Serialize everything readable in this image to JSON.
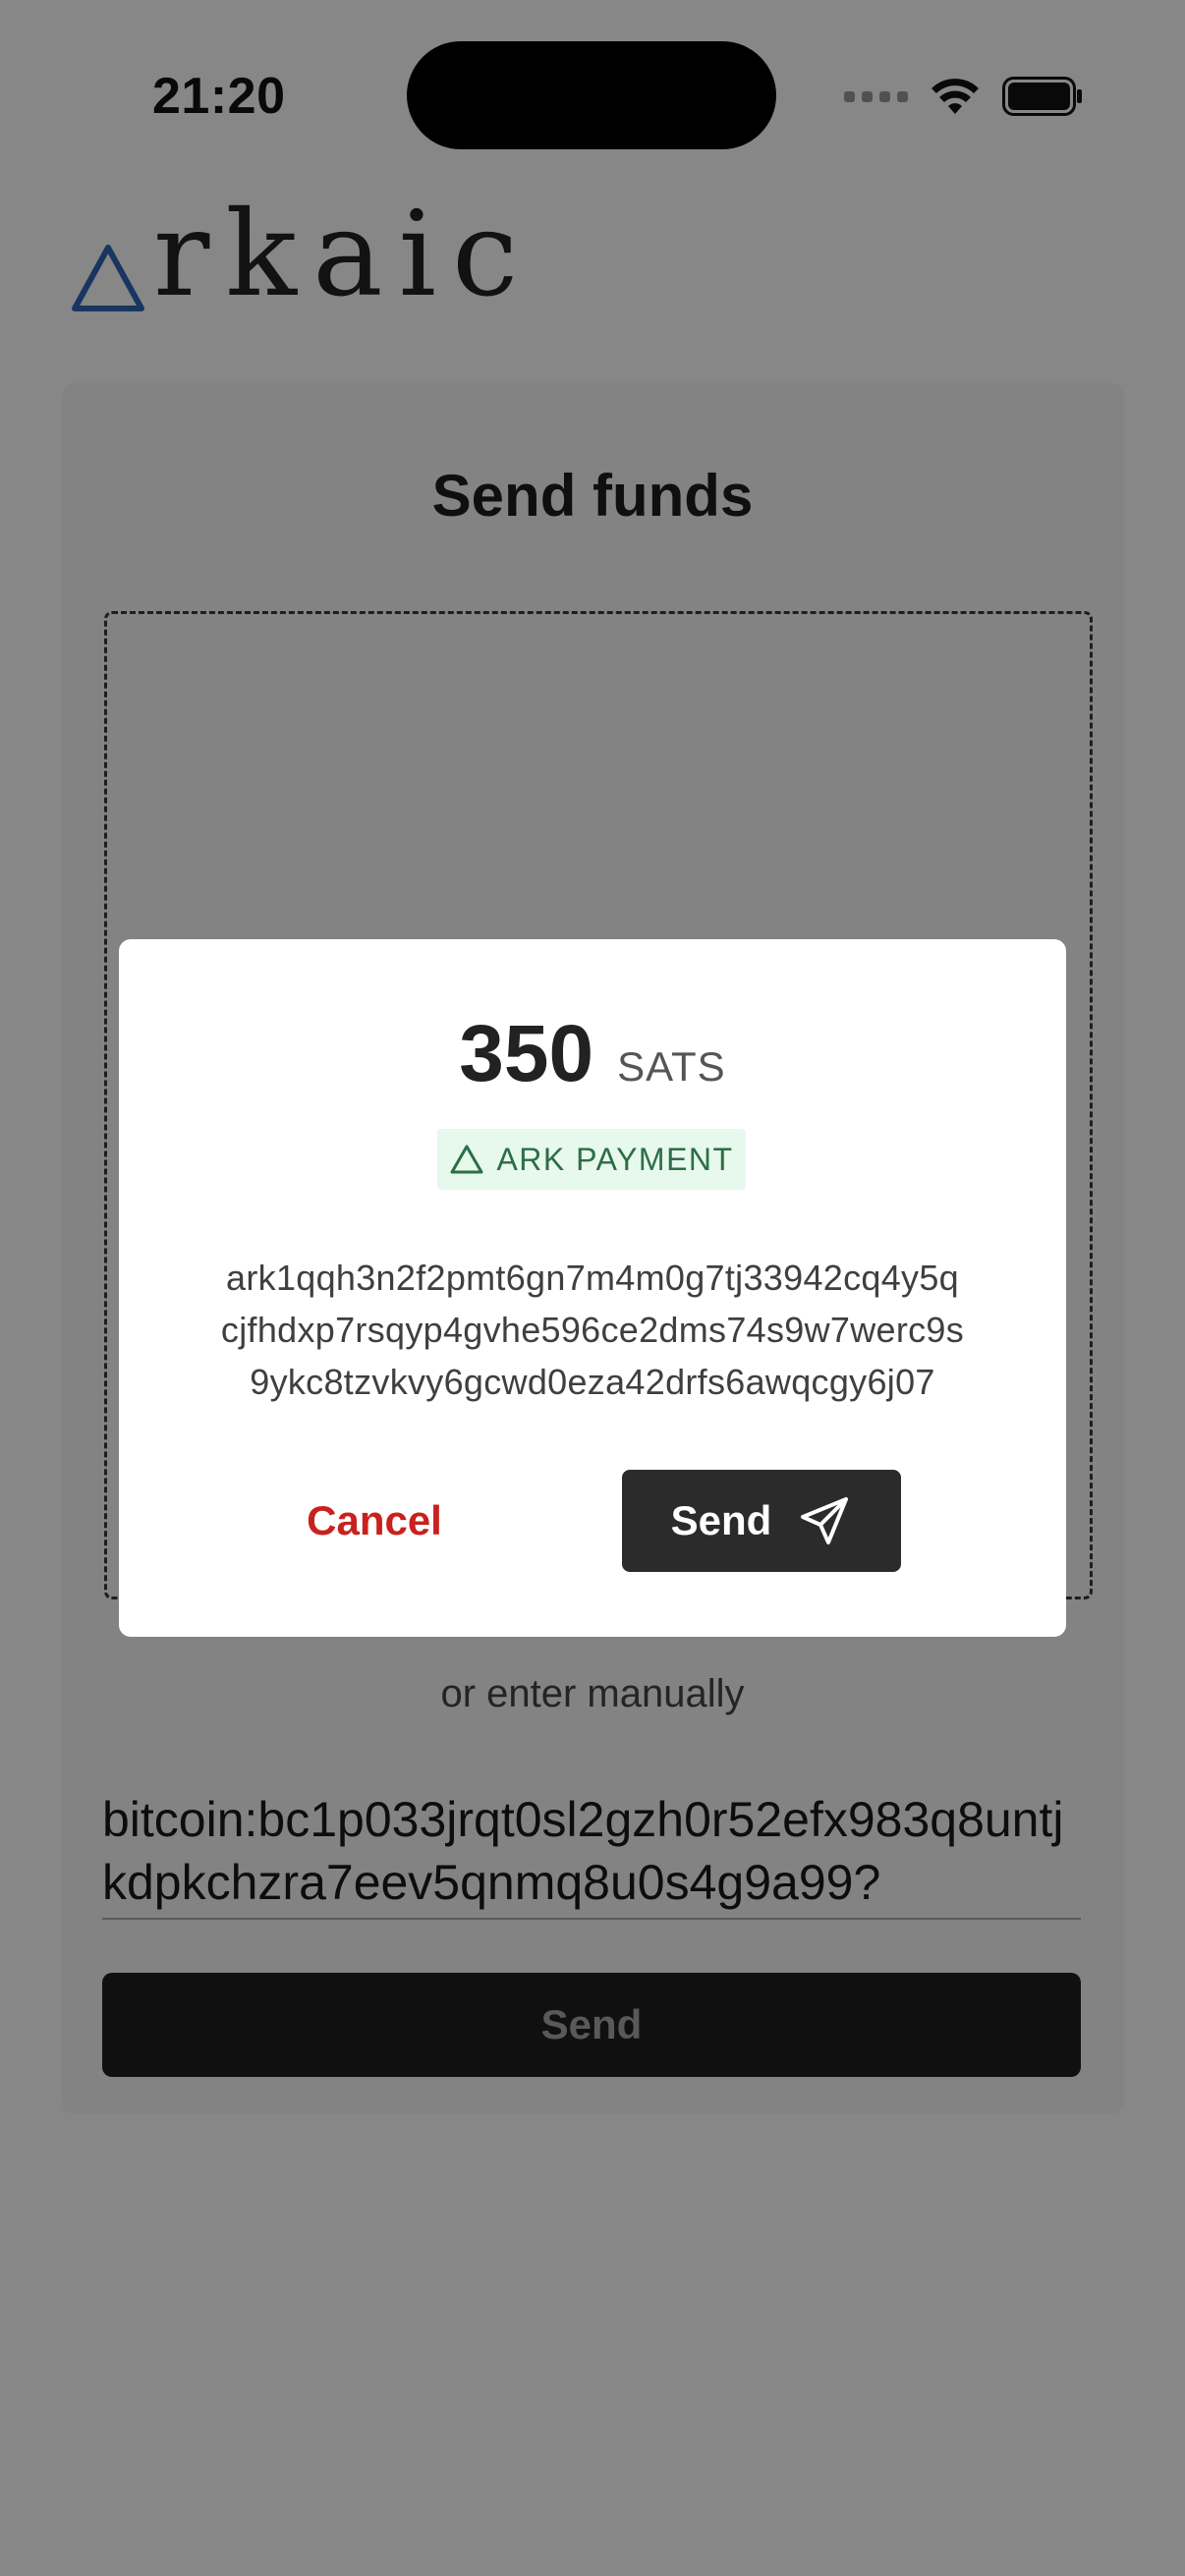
{
  "status_bar": {
    "time": "21:20"
  },
  "logo": {
    "text": "rkaic"
  },
  "page": {
    "title": "Send funds",
    "manual_label": "or enter manually",
    "address_value": "bitcoin:bc1p033jrqt0sl2gzh0r52efx983q8untjkdpkchzra7eev5qnmq8u0s4g9a99?",
    "send_label": "Send"
  },
  "modal": {
    "amount": "350",
    "unit": "SATS",
    "badge": "ARK PAYMENT",
    "address_lines": [
      "ark1qqh3n2f2pmt6gn7m4m0g7tj33942cq4y5q",
      "cjfhdxp7rsqyp4gvhe596ce2dms74s9w7werc9s",
      "9ykc8tzvkvy6gcwd0eza42drfs6awqcgy6j07"
    ],
    "cancel_label": "Cancel",
    "send_label": "Send"
  },
  "colors": {
    "cancel": "#c9211e",
    "badge_bg": "#e7f8ec",
    "badge_text": "#2b6e45",
    "logo_triangle": "#2f66b5",
    "button_dark": "#1f1f1f"
  },
  "icons": {
    "wifi": "wifi-icon",
    "battery": "battery-icon",
    "logo": "triangle-logo-icon",
    "badge": "triangle-icon",
    "send": "paper-plane-icon"
  }
}
